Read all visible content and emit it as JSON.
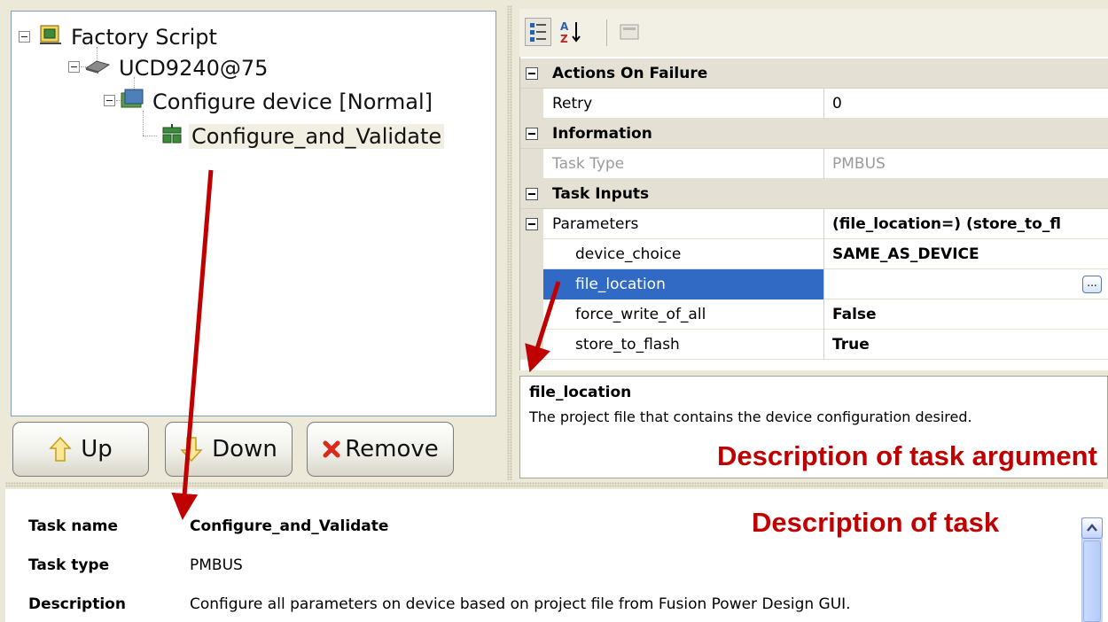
{
  "tree": {
    "root": "Factory Script",
    "device": "UCD9240@75",
    "group": "Configure device [Normal]",
    "task": "Configure_and_Validate"
  },
  "buttons": {
    "up": "Up",
    "down": "Down",
    "remove": "Remove"
  },
  "grid": {
    "categories": {
      "actions": "Actions On Failure",
      "information": "Information",
      "inputs": "Task Inputs"
    },
    "rows": {
      "retry": {
        "name": "Retry",
        "value": "0"
      },
      "task_type": {
        "name": "Task Type",
        "value": "PMBUS"
      },
      "parameters": {
        "name": "Parameters",
        "value": "(file_location=) (store_to_fl"
      },
      "device_choice": {
        "name": "device_choice",
        "value": "SAME_AS_DEVICE"
      },
      "file_location": {
        "name": "file_location",
        "value": "",
        "button": "..."
      },
      "force_write": {
        "name": "force_write_of_all",
        "value": "False"
      },
      "store_to_flash": {
        "name": "store_to_flash",
        "value": "True"
      }
    }
  },
  "help": {
    "title": "file_location",
    "text": "The project file that contains the device configuration desired.",
    "annotation": "Description of task argument"
  },
  "task_info": {
    "annotation": "Description of task",
    "name_label": "Task name",
    "name_value": "Configure_and_Validate",
    "type_label": "Task type",
    "type_value": "PMBUS",
    "desc_label": "Description",
    "desc_value": "Configure all parameters on device based on project file from Fusion Power Design GUI."
  },
  "colors": {
    "annotation_red": "#c00000",
    "selection_blue": "#316ac5",
    "category_gray": "#e4e1d4",
    "window_bg": "#ece9d8"
  },
  "icons": [
    "collapse-icon",
    "factory-script-icon",
    "chip-icon",
    "configure-folder-icon",
    "task-icon",
    "up-arrow-icon",
    "down-arrow-icon",
    "remove-x-icon",
    "categorized-icon",
    "alphabetical-icon",
    "property-pages-icon"
  ]
}
